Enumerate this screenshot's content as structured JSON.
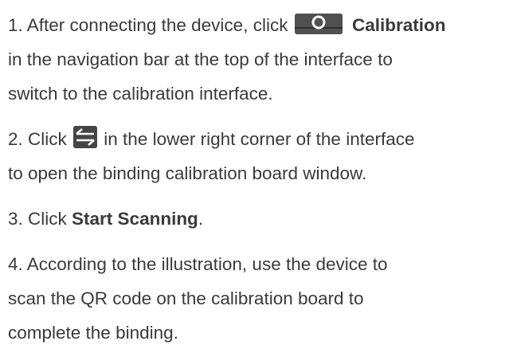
{
  "steps": [
    {
      "number": "1.",
      "line1_pre": "After connecting the device, click ",
      "line1_icon": "calibration-icon",
      "line1_bold": "Calibration",
      "line2": "in the navigation bar at the top of the interface to",
      "line3": "switch to the calibration interface."
    },
    {
      "number": "2.",
      "line1_pre": "Click ",
      "line1_icon": "swap-arrows-icon",
      "line1_post": " in the lower right corner of the interface",
      "line2": "to open the binding calibration board window."
    },
    {
      "number": "3.",
      "line1_pre": "Click ",
      "line1_bold": "Start Scanning",
      "line1_post": "."
    },
    {
      "number": "4.",
      "line1": "According to the illustration, use the device to",
      "line2": "scan the QR code on the calibration board to",
      "line3": "complete the binding."
    }
  ],
  "colors": {
    "text": "#3a3a3a",
    "icon_bg": "#505050",
    "icon_fg": "#ffffff"
  }
}
